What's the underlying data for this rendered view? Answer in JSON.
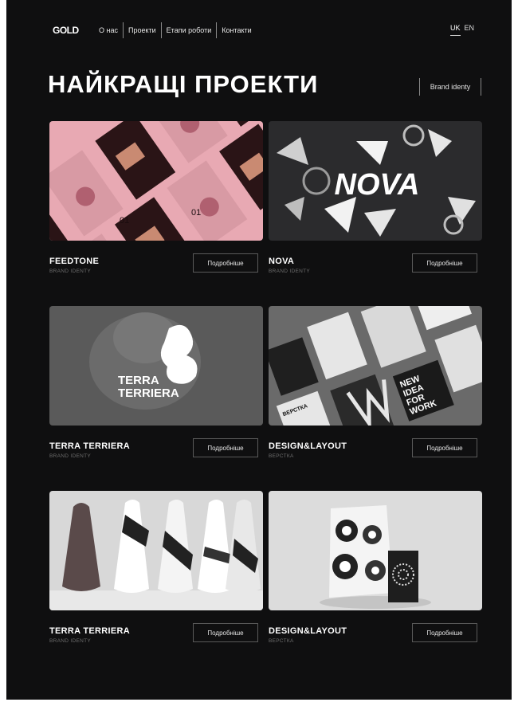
{
  "header": {
    "logo": "GOLD",
    "nav": [
      "О нас",
      "Проекти",
      "Етапи роботи",
      "Контакти"
    ],
    "languages": [
      "UK",
      "EN"
    ],
    "active_language": "UK"
  },
  "page_title": "НАЙКРАЩІ ПРОЕКТИ",
  "filter_label": "Brand identy",
  "more_label": "Подробніше",
  "projects": [
    {
      "title": "FEEDTONE",
      "subtitle": "BRAND IDENTY"
    },
    {
      "title": "NOVA",
      "subtitle": "BRAND IDENTY"
    },
    {
      "title": "TERRA TERRIERA",
      "subtitle": "BRAND IDENTY"
    },
    {
      "title": "DESIGN&LAYOUT",
      "subtitle": "ВЕРСТКА"
    },
    {
      "title": "TERRA TERRIERA",
      "subtitle": "BRAND IDENTY"
    },
    {
      "title": "DESIGN&LAYOUT",
      "subtitle": "ВЕРСТКА"
    }
  ],
  "thumb_texts": {
    "nova": "NOVA",
    "terra_line1": "TERRA",
    "terra_line2": "TERRIERA",
    "layout_pieces": [
      "NEW",
      "IDEA",
      "FOR",
      "WORK",
      "ВЕРСТКА"
    ],
    "feed_label": "01"
  },
  "colors": {
    "background": "#0f0f10",
    "feed_pink": "#e8a9b3",
    "feed_bag": "#2a1416",
    "feed_label": "#c98a72"
  }
}
